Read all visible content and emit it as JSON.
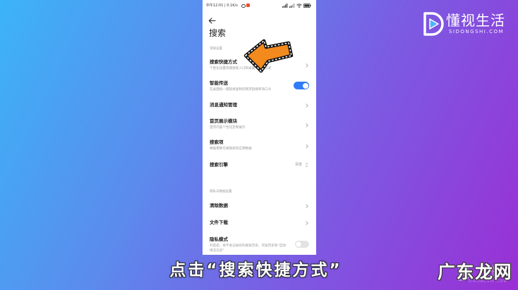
{
  "colors": {
    "bg_start": "#3cb4f8",
    "bg_mid1": "#5b8bed",
    "bg_mid2": "#7a5de3",
    "bg_end": "#9a2fd5",
    "toggle_on": "#2f7cf6",
    "toggle_off": "#e3e3e3",
    "arrow_fill": "#f28a1e",
    "title_text": "#1f1f1f",
    "subtitle_text": "#9a9a9a"
  },
  "status_bar": {
    "text": "中午12:01 | 0.1K/s",
    "icons": [
      "alarm-icon",
      "app-notification-icon",
      "signal-icon",
      "signal-icon",
      "wifi-icon",
      "battery-icon"
    ]
  },
  "header": {
    "back_icon": "back-arrow-icon",
    "title": "搜索"
  },
  "sections": [
    {
      "header": "常规设置",
      "items": [
        {
          "title": "搜索快捷方式",
          "subtitle": [
            "个性化设置快捷搜索入口和桌面",
            "方式"
          ],
          "control_icon": "chevron-right-icon"
        },
        {
          "title": "智能传送",
          "subtitle": "在桌面按一键就将复制的网页链接和淘口令",
          "toggle_on": true
        },
        {
          "title": "消息通知管理",
          "control_icon": "chevron-right-icon"
        },
        {
          "title": "首页展示模块",
          "subtitle": "首页内容个性化定制展示",
          "control_icon": "chevron-right-icon"
        },
        {
          "title": "搜索项",
          "subtitle": "根据需要可被搜索的应用数据",
          "control_icon": "chevron-right-icon"
        },
        {
          "title": "搜索引擎",
          "value": "百度",
          "control_icon": "updown-chevron-icon"
        }
      ]
    },
    {
      "header": "隐私与数据设置",
      "items": [
        {
          "title": "清除数据",
          "control_icon": "chevron-right-icon"
        },
        {
          "title": "文件下载",
          "control_icon": "chevron-right-icon"
        },
        {
          "title": "隐私模式",
          "subtitle": [
            "开启后，将不会记录您的搜索历史，浏览历史和“自动",
            "填充信息”"
          ],
          "toggle_on": false
        }
      ]
    }
  ],
  "annotation": {
    "arrow_icon": "arrow-left-icon",
    "caption": "点击“搜索快捷方式”"
  },
  "logo": {
    "icon": "play-d-logo-icon",
    "name": "懂视生活",
    "domain": "SIDONGSHI.COM"
  },
  "watermark": {
    "icon": "play-d-logo-icon",
    "brand_fragment": "生活",
    "domain": "SIDONGSHI.COM",
    "site": "广东龙网"
  }
}
